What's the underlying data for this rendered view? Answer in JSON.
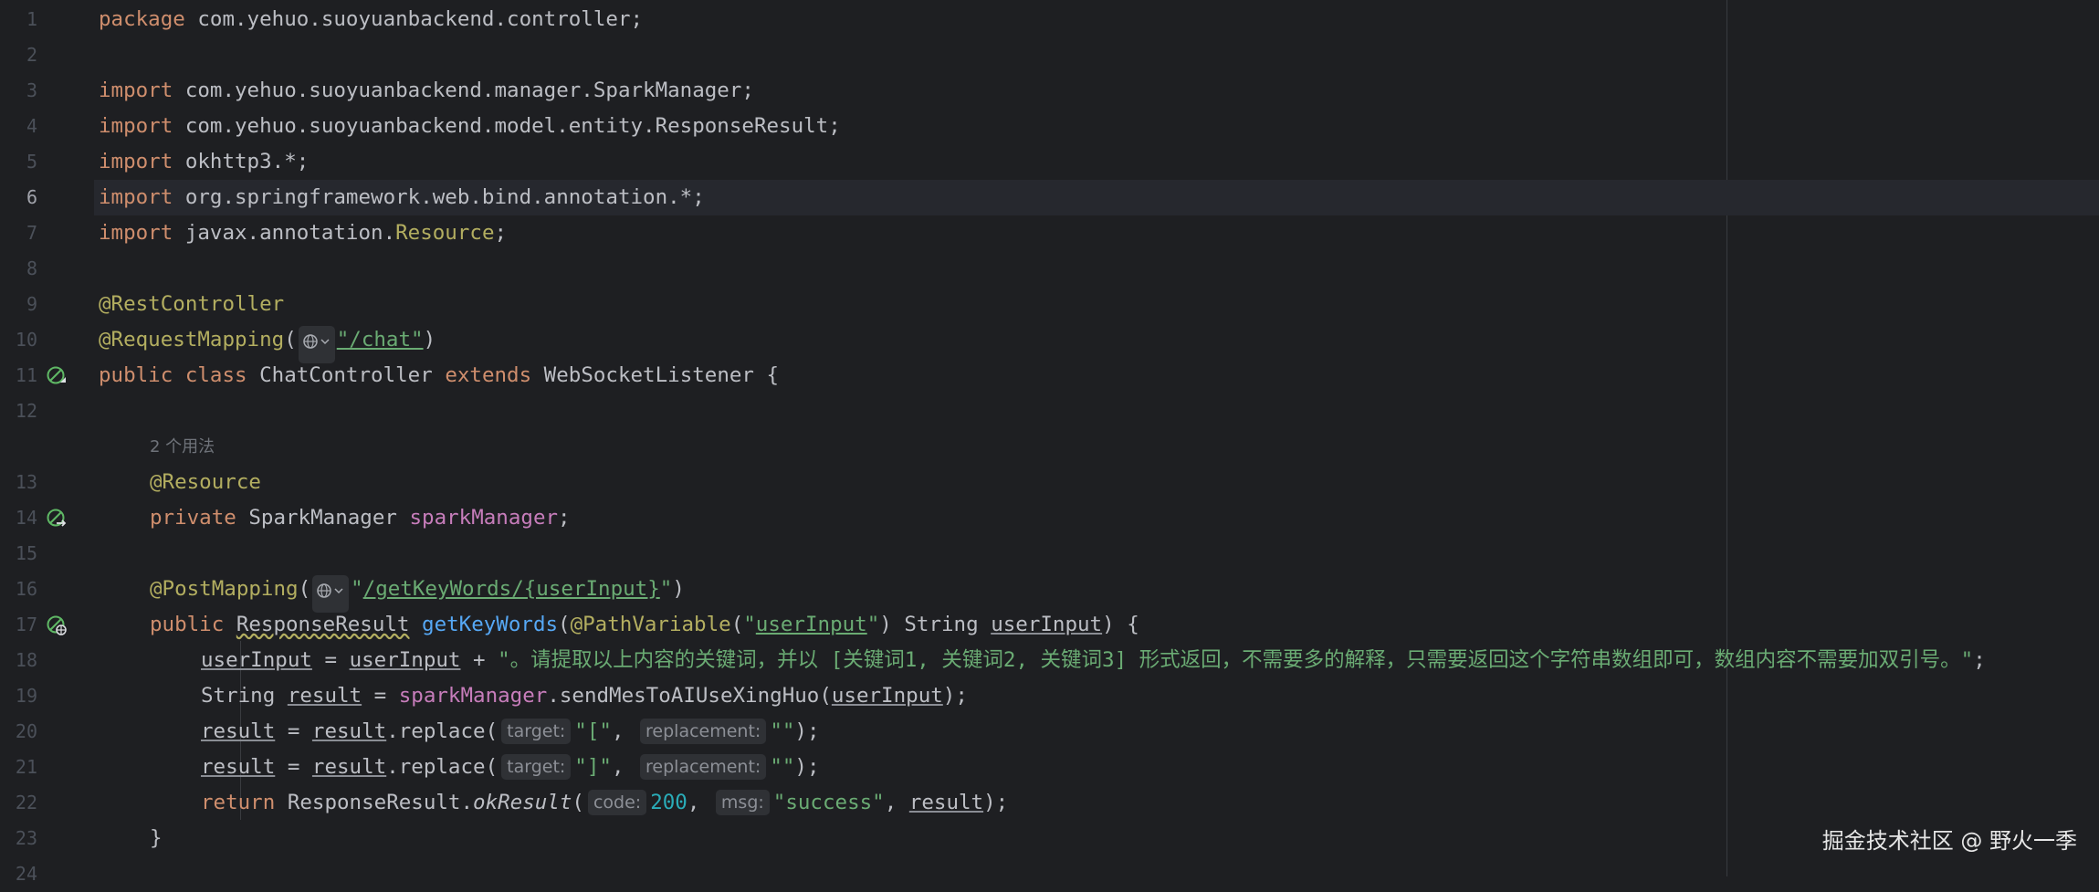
{
  "editor": {
    "line_numbers": [
      "1",
      "2",
      "3",
      "4",
      "5",
      "6",
      "7",
      "8",
      "9",
      "10",
      "11",
      "12",
      "13",
      "14",
      "15",
      "16",
      "17",
      "18",
      "19",
      "20",
      "21",
      "22",
      "23",
      "24"
    ],
    "current_line": "6",
    "usage_hint": "2 个用法",
    "code": {
      "l1_kw": "package",
      "l1_rest": " com.yehuo.suoyuanbackend.controller;",
      "import_kw": "import",
      "l3_rest": " com.yehuo.suoyuanbackend.manager.SparkManager;",
      "l4_rest": " com.yehuo.suoyuanbackend.model.entity.ResponseResult;",
      "l5_rest": " okhttp3.*;",
      "l6_rest": " org.springframework.web.bind.annotation.*;",
      "l7_rest": " javax.annotation.",
      "l7_cls": "Resource",
      "l7_end": ";",
      "l9_ann": "@RestController",
      "l10_ann": "@RequestMapping",
      "l10_open": "(",
      "l10_str": "\"/chat\"",
      "l10_close": ")",
      "l11_public": "public",
      "l11_class": "class",
      "l11_name": " ChatController ",
      "l11_extends": "extends",
      "l11_rest": " WebSocketListener {",
      "l13_ann": "@Resource",
      "l14_private": "private",
      "l14_type": " SparkManager ",
      "l14_field": "sparkManager",
      "l14_end": ";",
      "l16_ann": "@PostMapping",
      "l16_open": "(",
      "l16_q1": "\"",
      "l16_path": "/getKeyWords/{userInput}",
      "l16_q2": "\"",
      "l16_close": ")",
      "l17_public": "public",
      "l17_type": "ResponseResult",
      "l17_method": "getKeyWords",
      "l17_open": "(",
      "l17_ann": "@PathVariable",
      "l17_p1": "(",
      "l17_q1": "\"",
      "l17_argname": "userInput",
      "l17_q2": "\"",
      "l17_p2": ") String ",
      "l17_param": "userInput",
      "l17_end": ") {",
      "l18_var": "userInput",
      "l18_eq": " = ",
      "l18_var2": "userInput",
      "l18_plus": " + ",
      "l18_str": "\"。请提取以上内容的关键词，并以 [关键词1, 关键词2, 关键词3] 形式返回，不需要多的解释，只需要返回这个字符串数组即可，数组内容不需要加双引号。\"",
      "l18_end": ";",
      "l19_type": "String ",
      "l19_var": "result",
      "l19_eq": " = ",
      "l19_field": "sparkManager",
      "l19_call": ".sendMesToAIUseXingHuo(",
      "l19_arg": "userInput",
      "l19_end": ");",
      "result_var": "result",
      "assign": " = ",
      "replace_call": ".replace(",
      "hint_target": "target:",
      "hint_replacement": "replacement:",
      "l20_str1": "\"[\"",
      "l21_str1": "\"]\"",
      "comma": ",",
      "empty_str": "\"\"",
      "close_end": ");",
      "l22_return": "return",
      "l22_cls": " ResponseResult.",
      "l22_method": "okResult",
      "l22_open": "(",
      "hint_code": "code:",
      "l22_num": "200",
      "hint_msg": "msg:",
      "l22_str": "\"success\"",
      "l22_comma2": ", ",
      "l22_arg": "result",
      "l22_end": ");",
      "l23_brace": "}"
    }
  },
  "watermark": "掘金技术社区 @ 野火一季",
  "icons": {
    "line11": "implemented-class-icon",
    "line14": "autowired-bean-icon",
    "line17": "web-endpoint-icon",
    "globe": "globe-icon"
  }
}
